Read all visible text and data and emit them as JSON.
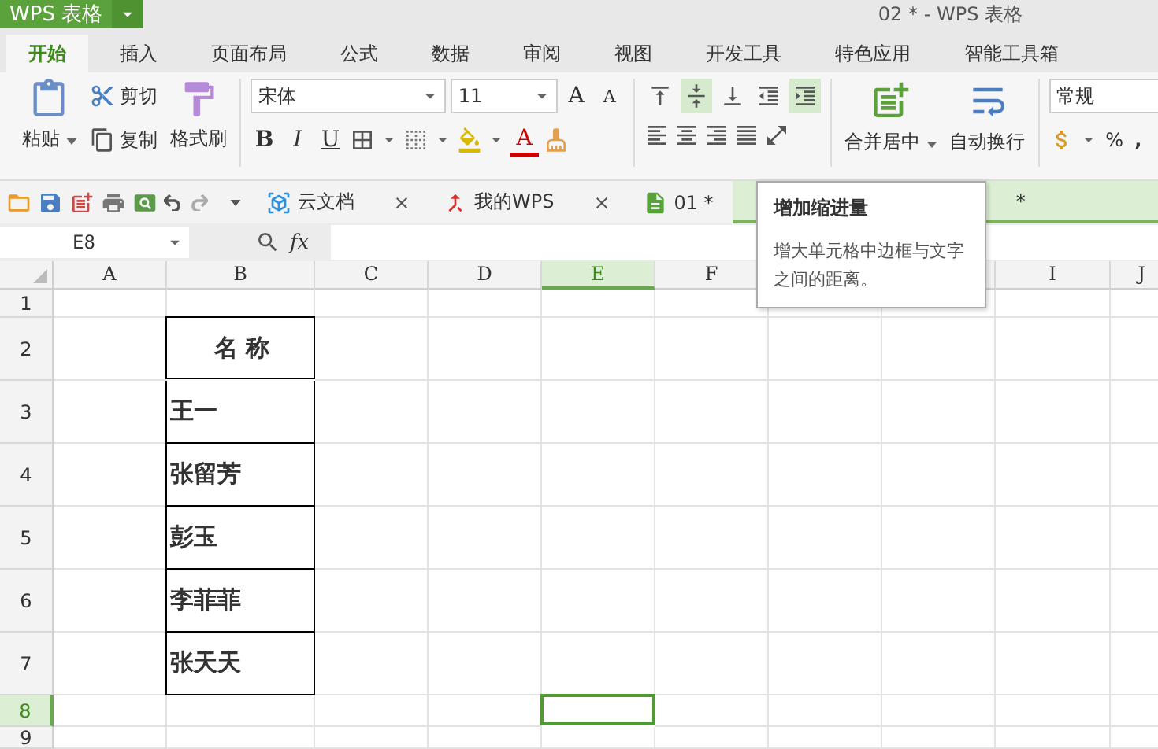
{
  "app_button": {
    "label": "WPS 表格"
  },
  "window": {
    "title": "02 * - WPS 表格"
  },
  "menu_tabs": [
    {
      "label": "开始",
      "selected": true
    },
    {
      "label": "插入",
      "selected": false
    },
    {
      "label": "页面布局",
      "selected": false
    },
    {
      "label": "公式",
      "selected": false
    },
    {
      "label": "数据",
      "selected": false
    },
    {
      "label": "审阅",
      "selected": false
    },
    {
      "label": "视图",
      "selected": false
    },
    {
      "label": "开发工具",
      "selected": false
    },
    {
      "label": "特色应用",
      "selected": false
    },
    {
      "label": "智能工具箱",
      "selected": false
    }
  ],
  "clipboard": {
    "paste": "粘贴",
    "cut": "剪切",
    "copy": "复制",
    "format_painter": "格式刷"
  },
  "font": {
    "name": "宋体",
    "size": "11",
    "bold": "B",
    "italic": "I",
    "underline": "U",
    "font_color": "A",
    "grow": "A",
    "shrink": "A"
  },
  "alignment_buttons": [
    {
      "kind": "top",
      "selected": false
    },
    {
      "kind": "middle",
      "selected": true
    },
    {
      "kind": "bottom",
      "selected": false
    },
    {
      "kind": "outdent",
      "selected": false
    },
    {
      "kind": "indent",
      "selected": true
    }
  ],
  "merge": "合并居中",
  "wrap": "自动换行",
  "number": {
    "format": "常规",
    "percent": "%",
    "comma": ","
  },
  "doc_tabs": [
    {
      "label": "云文档",
      "kind": "cloud",
      "selected": false
    },
    {
      "label": "我的WPS",
      "kind": "wps",
      "selected": false
    },
    {
      "label": "01 *",
      "kind": "sheet",
      "selected": false
    },
    {
      "label": "*",
      "kind": "sheet",
      "selected": true
    }
  ],
  "name_box": "E8",
  "fx": "fx",
  "columns": [
    {
      "label": "A",
      "selected": false
    },
    {
      "label": "B",
      "selected": false
    },
    {
      "label": "C",
      "selected": false
    },
    {
      "label": "D",
      "selected": false
    },
    {
      "label": "E",
      "selected": true
    },
    {
      "label": "F",
      "selected": false
    },
    {
      "label": "I",
      "selected": false
    },
    {
      "label": "J",
      "selected": false
    }
  ],
  "rows": [
    {
      "label": "1",
      "selected": false
    },
    {
      "label": "2",
      "selected": false,
      "b": "名 称",
      "kind": "header"
    },
    {
      "label": "3",
      "selected": false,
      "b": "王一",
      "kind": "name"
    },
    {
      "label": "4",
      "selected": false,
      "b": "张留芳",
      "kind": "name"
    },
    {
      "label": "5",
      "selected": false,
      "b": "彭玉",
      "kind": "name"
    },
    {
      "label": "6",
      "selected": false,
      "b": "李菲菲",
      "kind": "name"
    },
    {
      "label": "7",
      "selected": false,
      "b": "张天天",
      "kind": "name"
    },
    {
      "label": "8",
      "selected": true
    },
    {
      "label": "9",
      "selected": false
    }
  ],
  "tooltip": {
    "title": "增加缩进量",
    "body": "增大单元格中边框与文字之间的距离。"
  }
}
